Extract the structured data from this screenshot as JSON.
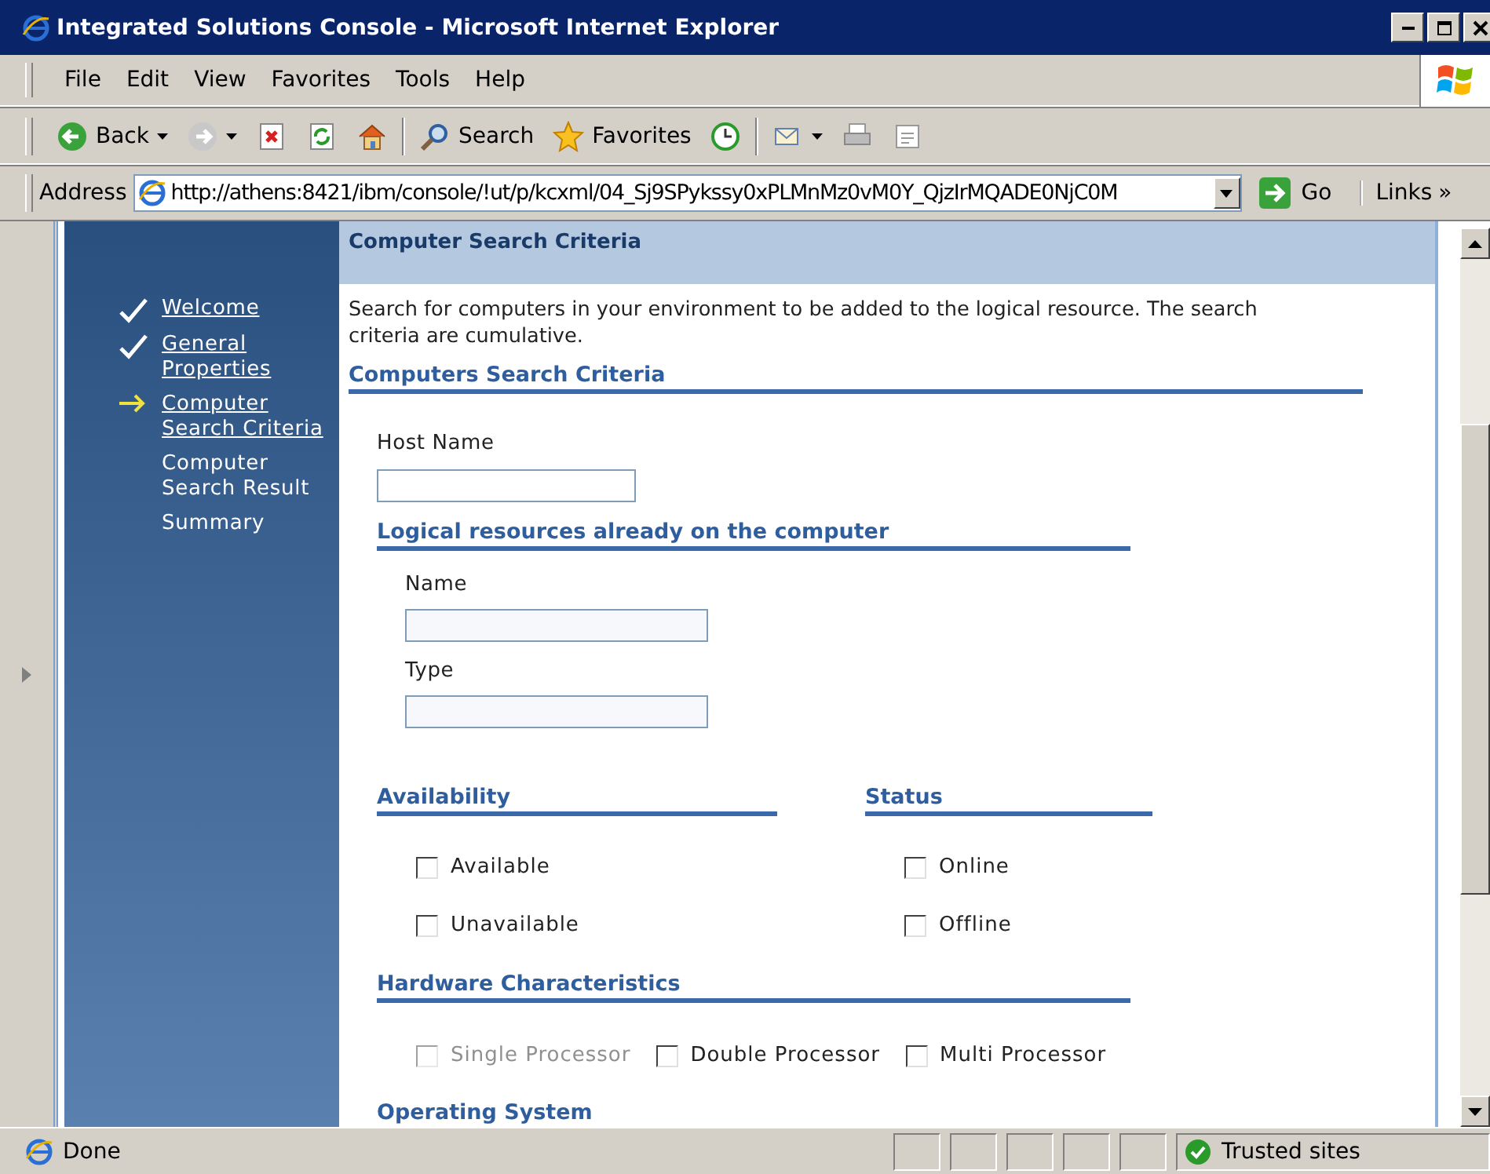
{
  "window": {
    "title": "Integrated Solutions Console - Microsoft Internet Explorer"
  },
  "menu": [
    {
      "label": "File"
    },
    {
      "label": "Edit"
    },
    {
      "label": "View"
    },
    {
      "label": "Favorites"
    },
    {
      "label": "Tools"
    },
    {
      "label": "Help"
    }
  ],
  "toolbar": [
    {
      "kind": "back",
      "label": "Back"
    },
    {
      "kind": "forward"
    },
    {
      "kind": "stop"
    },
    {
      "kind": "refresh"
    },
    {
      "kind": "home"
    },
    {
      "kind": "search",
      "label": "Search"
    },
    {
      "kind": "favorites",
      "label": "Favorites"
    },
    {
      "kind": "history"
    },
    {
      "kind": "mail"
    },
    {
      "kind": "print"
    },
    {
      "kind": "edit"
    }
  ],
  "address": {
    "label": "Address",
    "url": "http://athens:8421/ibm/console/!ut/p/kcxml/04_Sj9SPykssy0xPLMnMz0vM0Y_QjzIrMQADE0NjC0M",
    "go": "Go",
    "links": "Links",
    "links_chevron": "»"
  },
  "wizard": {
    "steps": [
      {
        "label": "Welcome",
        "kind": "done"
      },
      {
        "label": "General Properties",
        "kind": "done"
      },
      {
        "label": "Computer Search Criteria",
        "kind": "current"
      },
      {
        "label": "Computer Search Result",
        "kind": "pending"
      },
      {
        "label": "Summary",
        "kind": "pending"
      }
    ]
  },
  "panel": {
    "title": "Computer Search Criteria",
    "description": "Search for computers in your environment to be added to the logical resource. The search criteria are cumulative.",
    "section_title": "Computers Search Criteria",
    "host_field": {
      "label": "Host Name"
    },
    "logical_resources": {
      "title": "Logical resources already on the computer",
      "fields": [
        {
          "label": "Name"
        },
        {
          "label": "Type"
        }
      ]
    },
    "availability": {
      "title": "Availability",
      "options": [
        {
          "label": "Available",
          "checked": false,
          "disabled": false
        },
        {
          "label": "Unavailable",
          "checked": false,
          "disabled": false
        }
      ]
    },
    "status": {
      "title": "Status",
      "options": [
        {
          "label": "Online",
          "checked": false,
          "disabled": false
        },
        {
          "label": "Offline",
          "checked": false,
          "disabled": false
        }
      ]
    },
    "hardware": {
      "title": "Hardware Characteristics",
      "options": [
        {
          "label": "Single Processor",
          "checked": false,
          "disabled": true
        },
        {
          "label": "Double Processor",
          "checked": false,
          "disabled": false
        },
        {
          "label": "Multi Processor",
          "checked": false,
          "disabled": false
        }
      ]
    },
    "operating_system": {
      "title": "Operating System"
    }
  },
  "status_bar": {
    "text": "Done",
    "zone": "Trusted sites"
  }
}
